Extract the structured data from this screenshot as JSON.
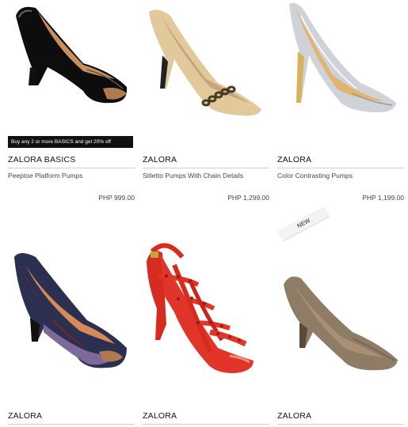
{
  "products": [
    {
      "brand": "ZALORA BASICS",
      "name": "Peeptoe Platform Pumps",
      "price": "PHP 999.00",
      "promo": "Buy any 2 or more BASICS and get 20% off",
      "image_icon": "black-patent-peeptoe-pump-image"
    },
    {
      "brand": "ZALORA",
      "name": "Stiletto Pumps With Chain Details",
      "price": "PHP 1,299.00",
      "image_icon": "nude-chain-stiletto-pump-image"
    },
    {
      "brand": "ZALORA",
      "name": "Color Contrasting Pumps",
      "price": "PHP 1,199.00",
      "image_icon": "silver-gold-pump-image"
    },
    {
      "brand": "ZALORA",
      "badge": "NEW",
      "image_icon": "colorblock-peeptoe-pump-image"
    },
    {
      "brand": "ZALORA",
      "image_icon": "red-studded-sandal-image"
    },
    {
      "brand": "ZALORA",
      "image_icon": "taupe-pointed-pump-image"
    }
  ],
  "colors": {
    "promo_bg": "#111111",
    "promo_text": "#ffffff",
    "divider": "#cfcfcf"
  }
}
